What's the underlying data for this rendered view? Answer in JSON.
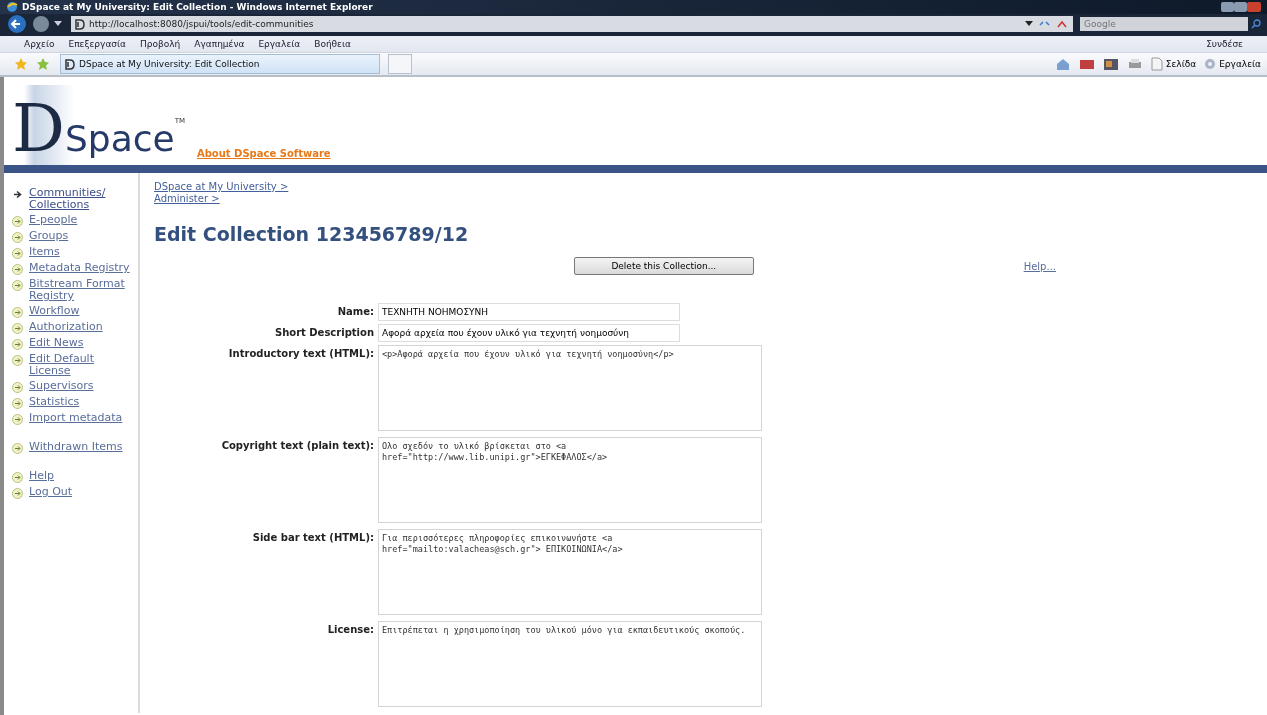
{
  "window": {
    "title": "DSpace at My University: Edit Collection - Windows Internet Explorer"
  },
  "browser": {
    "address": "http://localhost:8080/jspui/tools/edit-communities",
    "search_placeholder": "Google",
    "menu": [
      "Αρχείο",
      "Επεξεργασία",
      "Προβολή",
      "Αγαπημένα",
      "Εργαλεία",
      "Βοήθεια"
    ],
    "menu_right": "Συνδέσε",
    "tab": "DSpace at My University: Edit Collection",
    "toolbar": [
      "Σελίδα",
      "Εργαλεία"
    ]
  },
  "header": {
    "logo_initial": "D",
    "logo_word": "Space",
    "trademark": "TM",
    "about_link": "About DSpace Software"
  },
  "sidebar": {
    "groups": [
      [
        {
          "label": "Communities/ Collections",
          "selected": true
        },
        {
          "label": "E-people",
          "selected": false
        },
        {
          "label": "Groups",
          "selected": false
        },
        {
          "label": "Items",
          "selected": false
        },
        {
          "label": "Metadata Registry",
          "selected": false
        },
        {
          "label": "Bitstream Format Registry",
          "selected": false
        },
        {
          "label": "Workflow",
          "selected": false
        },
        {
          "label": "Authorization",
          "selected": false
        },
        {
          "label": "Edit News",
          "selected": false
        },
        {
          "label": "Edit Default License",
          "selected": false
        },
        {
          "label": "Supervisors",
          "selected": false
        },
        {
          "label": "Statistics",
          "selected": false
        },
        {
          "label": "Import metadata",
          "selected": false
        }
      ],
      [
        {
          "label": "Withdrawn Items",
          "selected": false
        }
      ],
      [
        {
          "label": "Help",
          "selected": false
        },
        {
          "label": "Log Out",
          "selected": false
        }
      ]
    ]
  },
  "breadcrumbs": [
    "DSpace at My University >",
    "Administer >"
  ],
  "heading": "Edit Collection 123456789/12",
  "delete_button": "Delete this Collection...",
  "help_link": "Help...",
  "fields": [
    {
      "kind": "input",
      "label": "Name:",
      "value": "ΤΕΧΝΗΤΗ ΝΟΗΜΟΣΥΝΗ"
    },
    {
      "kind": "input",
      "label": "Short Description",
      "value": "Αφορά αρχεία που έχουν υλικό για τεχνητή νοημοσύνη"
    },
    {
      "kind": "textarea",
      "label": "Introductory text (HTML):",
      "value": "<p>Αφορά αρχεία που έχουν υλικό για τεχνητή νοημοσύνη</p>"
    },
    {
      "kind": "textarea",
      "label": "Copyright text (plain text):",
      "value": "Ολο σχεδόν το υλικό βρίσκεται στο <a href=\"http://www.lib.unipi.gr\">ΕΓΚΕΦΑΛΟΣ</a>"
    },
    {
      "kind": "textarea",
      "label": "Side bar text (HTML):",
      "value": "Για περισσότερες πληροφορίες επικοινωνήστε <a href=\"mailto:valacheas@sch.gr\"> ΕΠΙΚΟΙΝΩΝΙΑ</a>"
    },
    {
      "kind": "textarea",
      "label": "License:",
      "value": "Επιτρέπεται η χρησιμοποίηση του υλικού μόνο για εκπαιδευτικούς σκοπούς."
    }
  ]
}
